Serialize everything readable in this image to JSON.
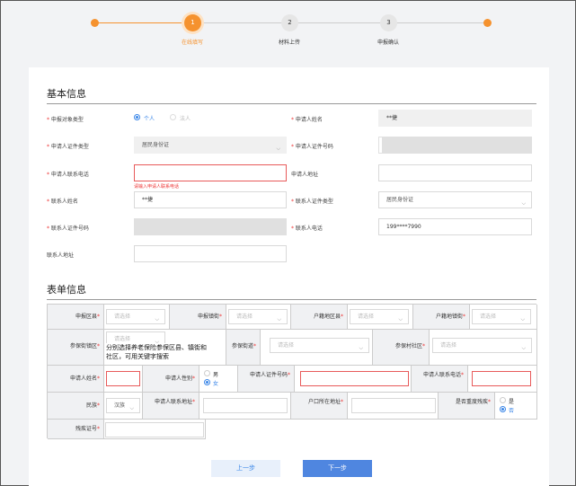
{
  "steps": [
    {
      "number": "1",
      "label": "在线填写",
      "active": true
    },
    {
      "number": "2",
      "label": "材料上传",
      "active": false
    },
    {
      "number": "3",
      "label": "申报确认",
      "active": false
    }
  ],
  "basic": {
    "title": "基本信息",
    "applicant_type_label": "申报对象类型",
    "applicant_type_options": [
      "个人",
      "法人"
    ],
    "applicant_name_label": "申请人姓名",
    "applicant_name_value": "**捷",
    "id_type_label": "申请人证件类型",
    "id_type_value": "居民身份证",
    "id_number_label": "申请人证件号码",
    "phone_label": "申请人联系电话",
    "phone_error": "请输入申请人联系电话",
    "address_label": "申请人地址",
    "contact_name_label": "联系人姓名",
    "contact_name_value": "**捷",
    "contact_id_type_label": "联系人证件类型",
    "contact_id_type_value": "居民身份证",
    "contact_id_number_label": "联系人证件号码",
    "contact_phone_label": "联系人电话",
    "contact_phone_value": "199****7990",
    "contact_address_label": "联系人地址"
  },
  "form": {
    "title": "表单信息",
    "placeholder": "请选择",
    "row1": [
      "申报区县",
      "申报镇街",
      "户籍地区县",
      "户籍地镇街"
    ],
    "row2": [
      "参保街镇区",
      "参保街道",
      "参保村社区"
    ],
    "tooltip": "分别选择养老保险参保区县、镇街和社区，可用关键字搜索",
    "row3": [
      "申请人姓名",
      "申请人性别",
      "申请人证件号码",
      "申请人联系电话"
    ],
    "gender_options": [
      "男",
      "女"
    ],
    "row4": [
      "民族",
      "申请人联系地址",
      "户口所在地址",
      "是否重度残疾"
    ],
    "ethnicity_value": "汉族",
    "disability_options": [
      "是",
      "否"
    ],
    "row5": [
      "残疾证号"
    ]
  },
  "buttons": {
    "prev": "上一步",
    "next": "下一步"
  },
  "colors": {
    "accent": "#f5922f",
    "primary": "#3a86e8",
    "error": "#e33333"
  }
}
